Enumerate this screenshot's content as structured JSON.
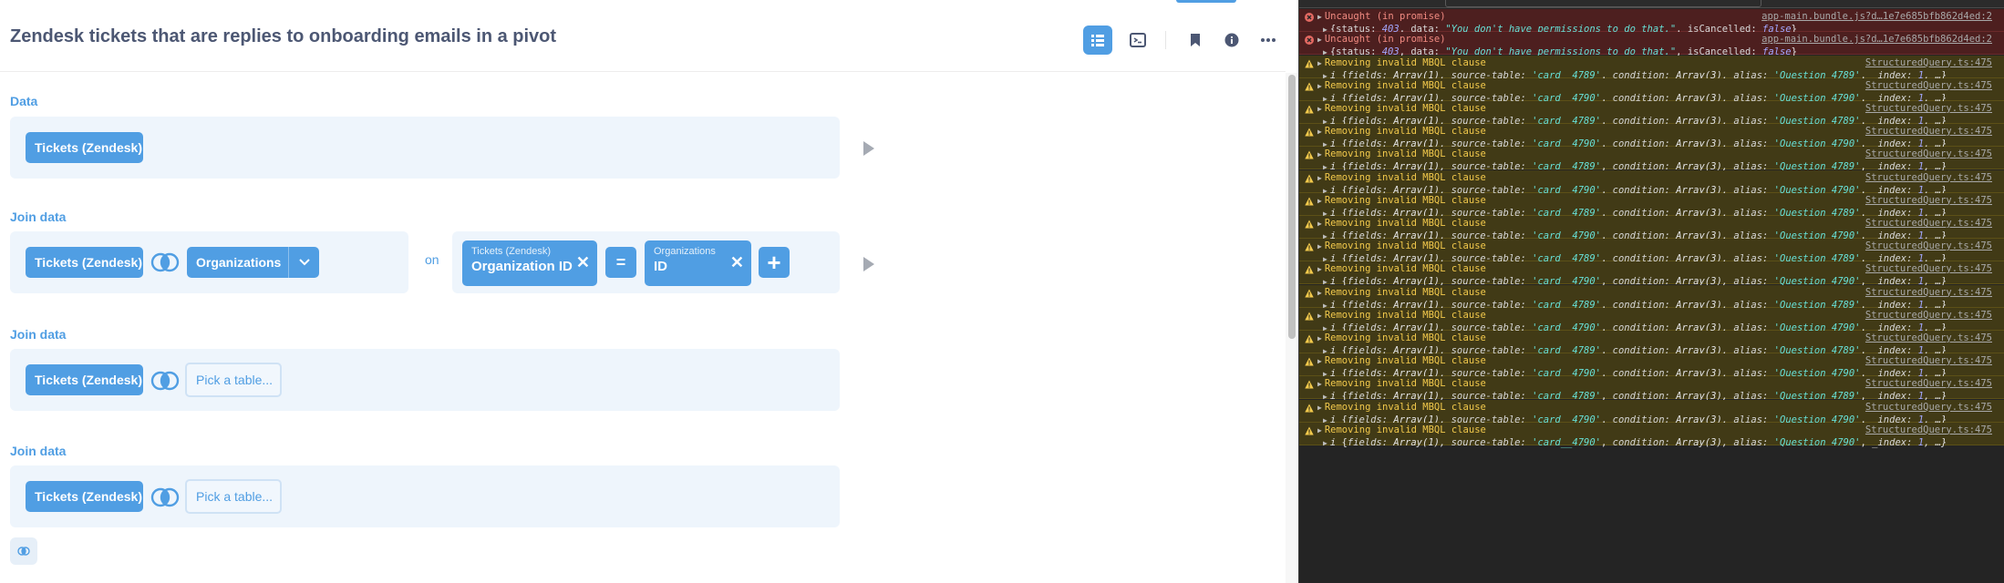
{
  "app": {
    "title": "Zendesk tickets that are replies to onboarding emails in a pivot",
    "header_icons": [
      "notebook-icon",
      "sql-icon",
      "bookmark-icon",
      "info-icon",
      "more-icon"
    ],
    "colors": {
      "brand": "#509ee3",
      "text": "#4c5773",
      "step_bg": "#eef5fc"
    }
  },
  "notebook": {
    "data_step": {
      "label": "Data",
      "table": "Tickets (Zendesk)"
    },
    "join_steps": [
      {
        "label": "Join data",
        "left_table": "Tickets (Zendesk)",
        "right_table": "Organizations",
        "on_label": "on",
        "left_column": {
          "table": "Tickets (Zendesk)",
          "column": "Organization ID"
        },
        "operator": "=",
        "right_column": {
          "table": "Organizations",
          "column": "ID"
        },
        "add_label": "+"
      },
      {
        "label": "Join data",
        "left_table": "Tickets (Zendesk)",
        "placeholder": "Pick a table..."
      },
      {
        "label": "Join data",
        "left_table": "Tickets (Zendesk)",
        "placeholder": "Pick a table..."
      }
    ]
  },
  "console": {
    "messages": [
      {
        "level": "error",
        "text": "Uncaught (in promise)",
        "source": "app-main.bundle.js?d…1e7e685bfb862d4ed:2",
        "detail_prefix": "{",
        "detail": [
          [
            "status",
            "403",
            "n"
          ],
          [
            "data",
            "\"You don't have permissions to do that.\"",
            "s"
          ],
          [
            "isCancelled",
            "false",
            "b"
          ]
        ]
      },
      {
        "level": "error",
        "text": "Uncaught (in promise)",
        "source": "app-main.bundle.js?d…1e7e685bfb862d4ed:2",
        "detail_prefix": "{",
        "detail": [
          [
            "status",
            "403",
            "n"
          ],
          [
            "data",
            "\"You don't have permissions to do that.\"",
            "s"
          ],
          [
            "isCancelled",
            "false",
            "b"
          ]
        ]
      },
      {
        "level": "warn",
        "text": "Removing invalid MBQL clause",
        "source": "StructuredQuery.ts:475",
        "card": "'card__4789'",
        "question": "'Question 4789'"
      },
      {
        "level": "warn",
        "text": "Removing invalid MBQL clause",
        "source": "StructuredQuery.ts:475",
        "card": "'card__4790'",
        "question": "'Question 4790'"
      },
      {
        "level": "warn",
        "text": "Removing invalid MBQL clause",
        "source": "StructuredQuery.ts:475",
        "card": "'card__4789'",
        "question": "'Question 4789'"
      },
      {
        "level": "warn",
        "text": "Removing invalid MBQL clause",
        "source": "StructuredQuery.ts:475",
        "card": "'card__4790'",
        "question": "'Question 4790'"
      },
      {
        "level": "warn",
        "text": "Removing invalid MBQL clause",
        "source": "StructuredQuery.ts:475",
        "card": "'card__4789'",
        "question": "'Question 4789'"
      },
      {
        "level": "warn",
        "text": "Removing invalid MBQL clause",
        "source": "StructuredQuery.ts:475",
        "card": "'card__4790'",
        "question": "'Question 4790'"
      },
      {
        "level": "warn",
        "text": "Removing invalid MBQL clause",
        "source": "StructuredQuery.ts:475",
        "card": "'card__4789'",
        "question": "'Question 4789'"
      },
      {
        "level": "warn",
        "text": "Removing invalid MBQL clause",
        "source": "StructuredQuery.ts:475",
        "card": "'card__4790'",
        "question": "'Question 4790'"
      },
      {
        "level": "warn",
        "text": "Removing invalid MBQL clause",
        "source": "StructuredQuery.ts:475",
        "card": "'card__4789'",
        "question": "'Question 4789'"
      },
      {
        "level": "warn",
        "text": "Removing invalid MBQL clause",
        "source": "StructuredQuery.ts:475",
        "card": "'card__4790'",
        "question": "'Question 4790'"
      },
      {
        "level": "warn",
        "text": "Removing invalid MBQL clause",
        "source": "StructuredQuery.ts:475",
        "card": "'card__4789'",
        "question": "'Question 4789'"
      },
      {
        "level": "warn",
        "text": "Removing invalid MBQL clause",
        "source": "StructuredQuery.ts:475",
        "card": "'card__4790'",
        "question": "'Question 4790'"
      },
      {
        "level": "warn",
        "text": "Removing invalid MBQL clause",
        "source": "StructuredQuery.ts:475",
        "card": "'card__4789'",
        "question": "'Question 4789'"
      },
      {
        "level": "warn",
        "text": "Removing invalid MBQL clause",
        "source": "StructuredQuery.ts:475",
        "card": "'card__4790'",
        "question": "'Question 4790'"
      },
      {
        "level": "warn",
        "text": "Removing invalid MBQL clause",
        "source": "StructuredQuery.ts:475",
        "card": "'card__4789'",
        "question": "'Question 4789'"
      },
      {
        "level": "warn",
        "text": "Removing invalid MBQL clause",
        "source": "StructuredQuery.ts:475",
        "card": "'card__4790'",
        "question": "'Question 4790'"
      },
      {
        "level": "warn",
        "text": "Removing invalid MBQL clause",
        "source": "StructuredQuery.ts:475",
        "card": "'card__4790'",
        "question": "'Question 4790'"
      }
    ],
    "warn_fields": {
      "fields": "Array(1)",
      "condition": "Array(3)",
      "index": "1"
    }
  }
}
